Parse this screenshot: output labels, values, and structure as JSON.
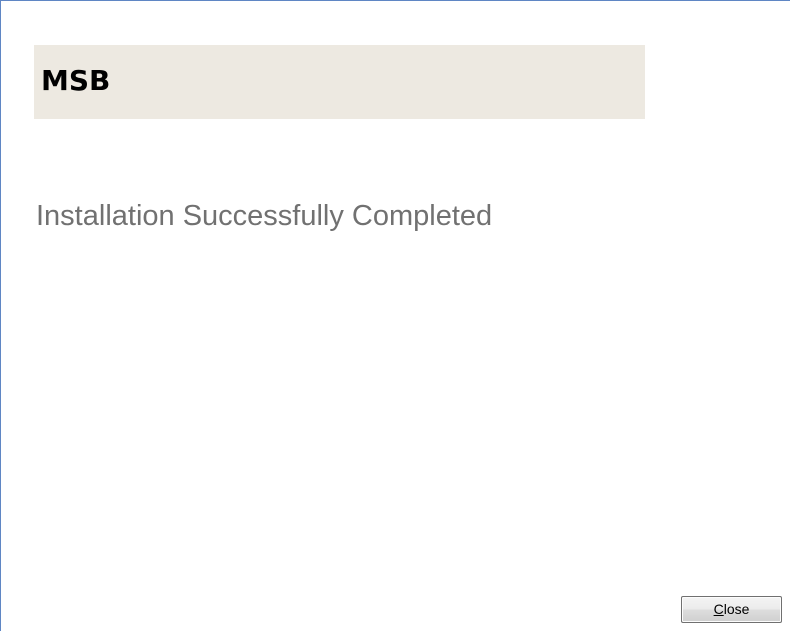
{
  "banner": {
    "title": "MSB",
    "background_color": "#ede9e1"
  },
  "status": {
    "message": "Installation Successfully Completed"
  },
  "footer": {
    "close_button": {
      "mnemonic": "C",
      "rest": "lose"
    }
  },
  "colors": {
    "window_border": "#5f86c4",
    "status_text": "#717171"
  }
}
